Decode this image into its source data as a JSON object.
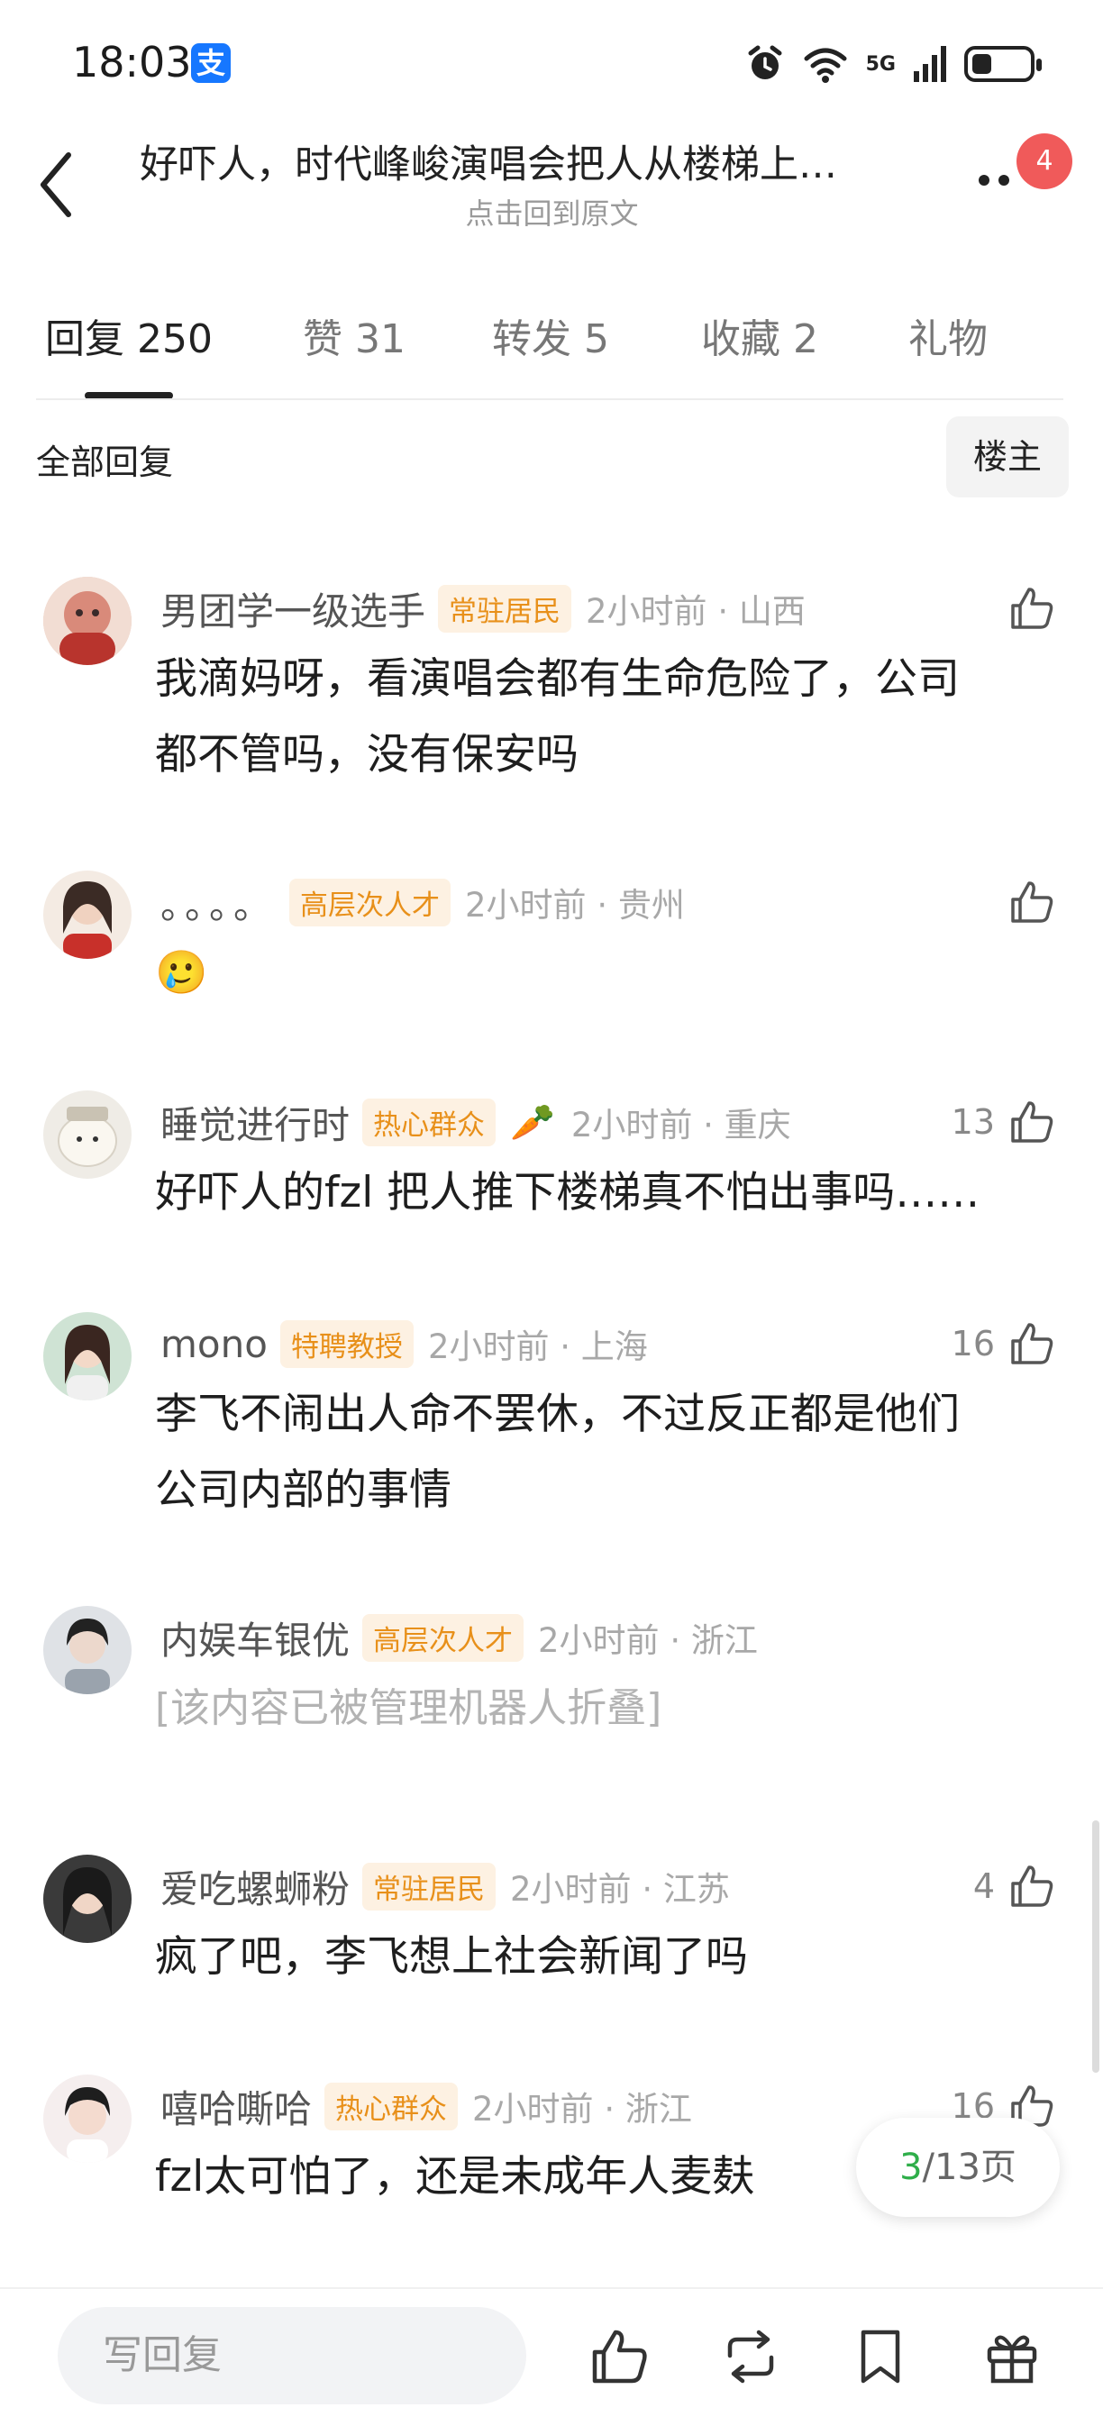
{
  "status_bar": {
    "time": "18:03",
    "app_badge": "支",
    "network": "5G",
    "battery_level": 0.35
  },
  "header": {
    "title": "好吓人，时代峰峻演唱会把人从楼梯上…",
    "subtitle": "点击回到原文",
    "badge_count": "4"
  },
  "tabs": [
    {
      "label": "回复",
      "count": "250"
    },
    {
      "label": "赞",
      "count": "31"
    },
    {
      "label": "转发",
      "count": "5"
    },
    {
      "label": "收藏",
      "count": "2"
    },
    {
      "label": "礼物",
      "count": ""
    }
  ],
  "filter": {
    "label": "全部回复",
    "owner_button": "楼主"
  },
  "comments": [
    {
      "name": "男团学一级选手",
      "tag": "常驻居民",
      "time": "2小时前 · 山西",
      "likes": "",
      "text_lines": [
        "我滴妈呀，看演唱会都有生命危险了，公司",
        "都不管吗，没有保安吗"
      ]
    },
    {
      "name": "。。。。",
      "tag": "高层次人才",
      "time": "2小时前 · 贵州",
      "likes": "",
      "text_lines": [
        "🥲"
      ]
    },
    {
      "name": "睡觉进行时",
      "tag": "热心群众",
      "emoji": "🥕",
      "time": "2小时前 · 重庆",
      "likes": "13",
      "text_lines": [
        "好吓人的fzl 把人推下楼梯真不怕出事吗……"
      ]
    },
    {
      "name": "mono",
      "tag": "特聘教授",
      "time": "2小时前 · 上海",
      "likes": "16",
      "text_lines": [
        "李飞不闹出人命不罢休，不过反正都是他们",
        "公司内部的事情"
      ]
    },
    {
      "name": "内娱车银优",
      "tag": "高层次人才",
      "time": "2小时前 · 浙江",
      "likes": "",
      "text_lines": [
        "[该内容已被管理机器人折叠]"
      ]
    },
    {
      "name": "爱吃螺蛳粉",
      "tag": "常驻居民",
      "time": "2小时前 · 江苏",
      "likes": "4",
      "text_lines": [
        "疯了吧，李飞想上社会新闻了吗"
      ]
    },
    {
      "name": "嘻哈嘶哈",
      "tag": "热心群众",
      "time": "2小时前 · 浙江",
      "likes": "16",
      "text_lines": [
        "fzl太可怕了，还是未成年人麦麸"
      ]
    }
  ],
  "pagination": {
    "current": "3",
    "total_text": "/13页"
  },
  "bottom_bar": {
    "reply_placeholder": "写回复"
  }
}
